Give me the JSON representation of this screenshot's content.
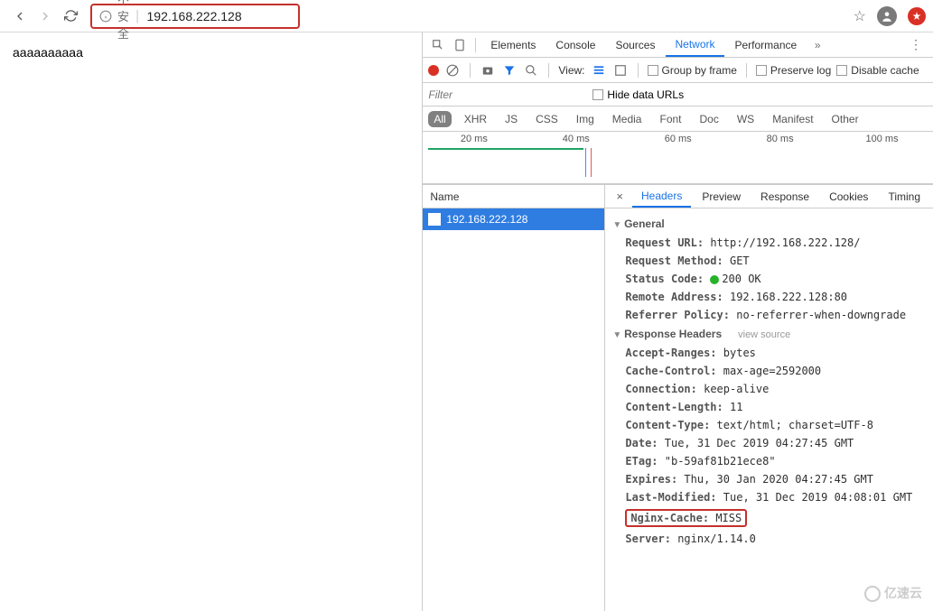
{
  "chrome": {
    "insecure_label": "不安全",
    "url": "192.168.222.128"
  },
  "page": {
    "body_text": "aaaaaaaaaa"
  },
  "devtools": {
    "tabs": [
      "Elements",
      "Console",
      "Sources",
      "Network",
      "Performance"
    ],
    "active_tab": "Network",
    "toolbar": {
      "view_label": "View:",
      "group_by_frame": "Group by frame",
      "preserve_log": "Preserve log",
      "disable_cache": "Disable cache"
    },
    "filter": {
      "placeholder": "Filter",
      "hide_data_urls": "Hide data URLs"
    },
    "types": [
      "All",
      "XHR",
      "JS",
      "CSS",
      "Img",
      "Media",
      "Font",
      "Doc",
      "WS",
      "Manifest",
      "Other"
    ],
    "timeline": {
      "ticks": [
        "20 ms",
        "40 ms",
        "60 ms",
        "80 ms",
        "100 ms"
      ]
    },
    "request_list": {
      "name_header": "Name",
      "items": [
        "192.168.222.128"
      ]
    },
    "detail": {
      "tabs": [
        "Headers",
        "Preview",
        "Response",
        "Cookies",
        "Timing"
      ],
      "active_tab": "Headers",
      "sections": {
        "general": {
          "title": "General",
          "rows": [
            {
              "k": "Request URL:",
              "v": "http://192.168.222.128/"
            },
            {
              "k": "Request Method:",
              "v": "GET"
            },
            {
              "k": "Status Code:",
              "v": "200 OK",
              "status": true
            },
            {
              "k": "Remote Address:",
              "v": "192.168.222.128:80"
            },
            {
              "k": "Referrer Policy:",
              "v": "no-referrer-when-downgrade"
            }
          ]
        },
        "response_headers": {
          "title": "Response Headers",
          "view_source": "view source",
          "rows": [
            {
              "k": "Accept-Ranges:",
              "v": "bytes"
            },
            {
              "k": "Cache-Control:",
              "v": "max-age=2592000"
            },
            {
              "k": "Connection:",
              "v": "keep-alive"
            },
            {
              "k": "Content-Length:",
              "v": "11"
            },
            {
              "k": "Content-Type:",
              "v": "text/html; charset=UTF-8"
            },
            {
              "k": "Date:",
              "v": "Tue, 31 Dec 2019 04:27:45 GMT"
            },
            {
              "k": "ETag:",
              "v": "\"b-59af81b21ece8\""
            },
            {
              "k": "Expires:",
              "v": "Thu, 30 Jan 2020 04:27:45 GMT"
            },
            {
              "k": "Last-Modified:",
              "v": "Tue, 31 Dec 2019 04:08:01 GMT"
            },
            {
              "k": "Nginx-Cache:",
              "v": "MISS",
              "highlight": true
            },
            {
              "k": "Server:",
              "v": "nginx/1.14.0"
            }
          ]
        }
      }
    }
  },
  "watermark": "亿速云"
}
